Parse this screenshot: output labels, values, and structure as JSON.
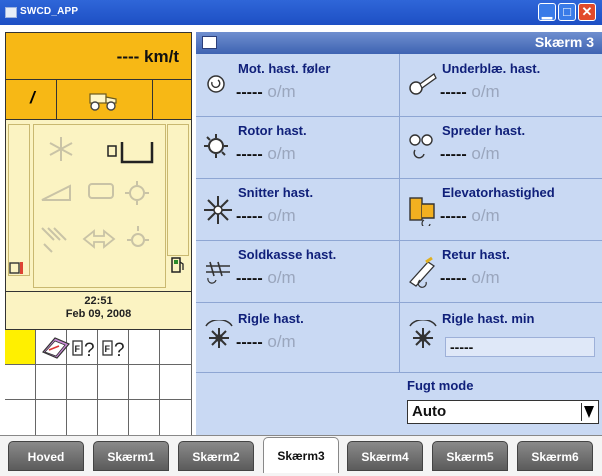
{
  "window": {
    "title": "SWCD_APP",
    "close": "✕",
    "minimize": "▁",
    "maximize": "□"
  },
  "speed": {
    "value": "---- km/t"
  },
  "mode": {
    "indicator": "/"
  },
  "datetime": {
    "time": "22:51",
    "date": "Feb 09, 2008"
  },
  "screen": {
    "title": "Skærm 3"
  },
  "sensors": [
    {
      "label": "Mot. hast. føler",
      "dash": "-----",
      "unit": "o/m",
      "icon": "motor-sensor-icon"
    },
    {
      "label": "Underblæ. hast.",
      "dash": "-----",
      "unit": "o/m",
      "icon": "blower-icon"
    },
    {
      "label": "Rotor hast.",
      "dash": "-----",
      "unit": "o/m",
      "icon": "rotor-icon"
    },
    {
      "label": "Spreder hast.",
      "dash": "-----",
      "unit": "o/m",
      "icon": "spreader-icon"
    },
    {
      "label": "Snitter hast.",
      "dash": "-----",
      "unit": "o/m",
      "icon": "chopper-icon"
    },
    {
      "label": "Elevatorhastighed",
      "dash": "-----",
      "unit": "o/m",
      "icon": "elevator-icon"
    },
    {
      "label": "Soldkasse hast.",
      "dash": "-----",
      "unit": "o/m",
      "icon": "sieve-box-icon"
    },
    {
      "label": "Retur hast.",
      "dash": "-----",
      "unit": "o/m",
      "icon": "return-icon"
    },
    {
      "label": "Rigle hast.",
      "dash": "-----",
      "unit": "o/m",
      "icon": "rigle-icon"
    },
    {
      "label": "Rigle hast. min",
      "dash": "-----",
      "unit": "",
      "icon": "rigle-min-icon"
    }
  ],
  "fugt": {
    "label": "Fugt mode",
    "value": "Auto"
  },
  "tabs": [
    "Hoved",
    "Skærm1",
    "Skærm2",
    "Skærm3",
    "Skærm4",
    "Skærm5",
    "Skærm6"
  ],
  "active_tab": "Skærm3",
  "colors": {
    "accent_yellow": "#f7b815",
    "panel_blue": "#c9d9f3",
    "header_blue": "#3e63b2",
    "label_navy": "#10207a"
  }
}
